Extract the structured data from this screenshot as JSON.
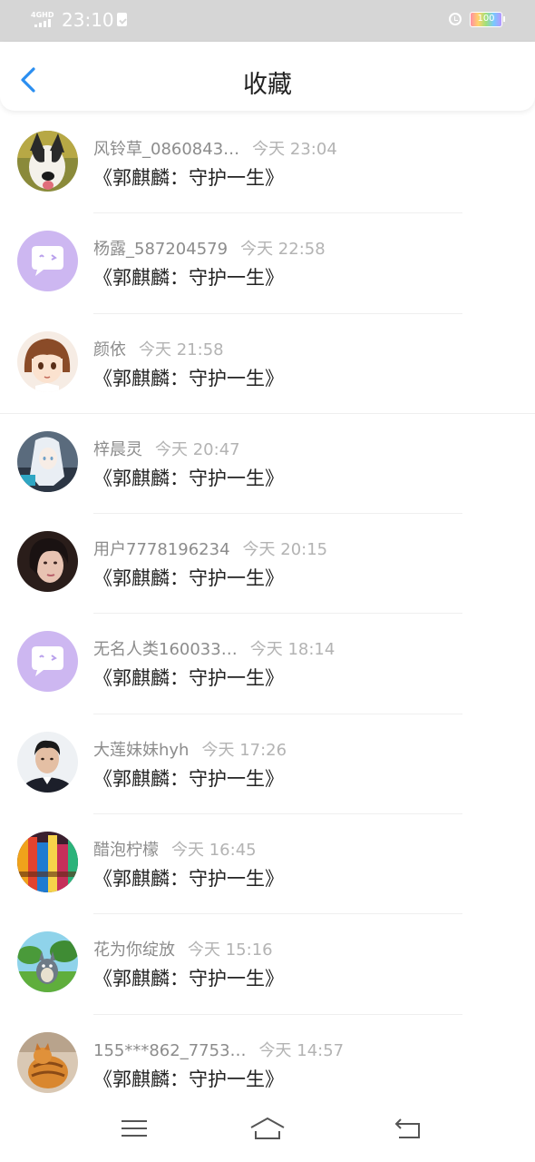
{
  "status_bar": {
    "network": "4GHD",
    "time": "23:10",
    "battery": "100"
  },
  "header": {
    "title": "收藏",
    "back_icon": "chevron-left-icon",
    "accent_color": "#2a8ef0"
  },
  "favorites": [
    {
      "user": "风铃草_0860843…",
      "time": "今天 23:04",
      "title": "《郭麒麟：守护一生》",
      "avatar": "dog-photo"
    },
    {
      "user": "杨露_587204579",
      "time": "今天 22:58",
      "title": "《郭麒麟：守护一生》",
      "avatar": "default-chat-bubble"
    },
    {
      "user": "颜依",
      "time": "今天 21:58",
      "title": "《郭麒麟：守护一生》",
      "avatar": "anime-girl"
    },
    {
      "user": "梓晨灵",
      "time": "今天 20:47",
      "title": "《郭麒麟：守护一生》",
      "avatar": "anime-white-hair"
    },
    {
      "user": "用户7778196234",
      "time": "今天 20:15",
      "title": "《郭麒麟：守护一生》",
      "avatar": "girl-photo"
    },
    {
      "user": "无名人类160033…",
      "time": "今天 18:14",
      "title": "《郭麒麟：守护一生》",
      "avatar": "default-chat-bubble"
    },
    {
      "user": "大莲妹妹hyh",
      "time": "今天 17:26",
      "title": "《郭麒麟：守护一生》",
      "avatar": "man-photo"
    },
    {
      "user": "醋泡柠檬",
      "time": "今天 16:45",
      "title": "《郭麒麟：守护一生》",
      "avatar": "colorful-shelf"
    },
    {
      "user": "花为你绽放",
      "time": "今天 15:16",
      "title": "《郭麒麟：守护一生》",
      "avatar": "totoro"
    },
    {
      "user": "155***862_7753…",
      "time": "今天 14:57",
      "title": "《郭麒麟：守护一生》",
      "avatar": "cat-photo"
    }
  ],
  "navbar": {
    "menu_icon": "menu-icon",
    "home_icon": "home-icon",
    "back_icon": "back-arrow-icon"
  }
}
